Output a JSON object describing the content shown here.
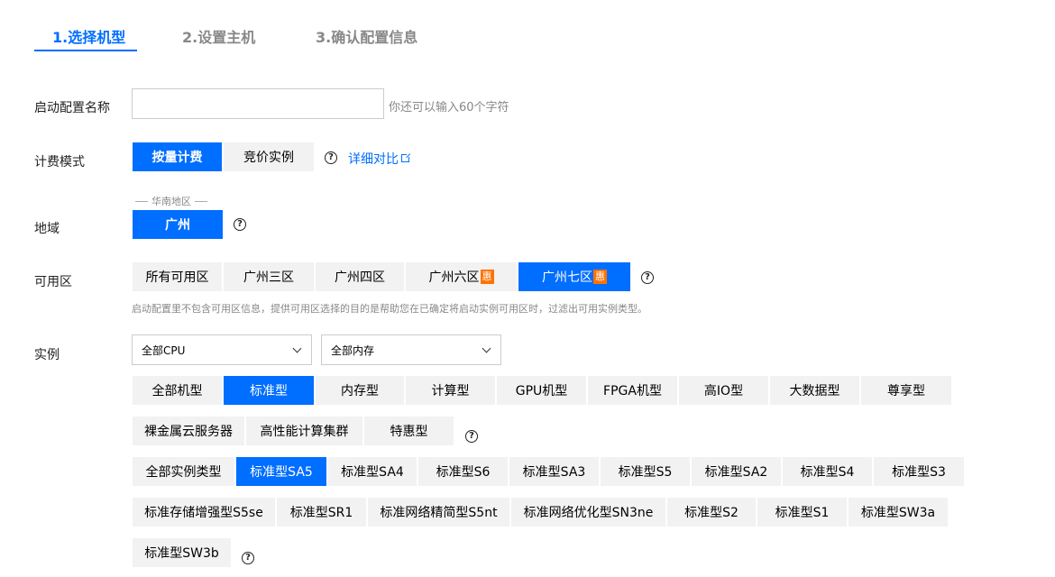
{
  "tabs": [
    "1.选择机型",
    "2.设置主机",
    "3.确认配置信息"
  ],
  "launch_config": {
    "label": "启动配置名称",
    "value": "",
    "hint": "你还可以输入60个字符"
  },
  "billing": {
    "label": "计费模式",
    "options": [
      "按量计费",
      "竞价实例"
    ],
    "selected": "按量计费",
    "compare_link": "详细对比"
  },
  "region": {
    "label": "地域",
    "group": "华南地区",
    "options": [
      "广州"
    ],
    "selected": "广州"
  },
  "zone": {
    "label": "可用区",
    "options": [
      "所有可用区",
      "广州三区",
      "广州四区",
      "广州六区",
      "广州七区"
    ],
    "badge": "惠",
    "selected": "广州七区",
    "note": "启动配置里不包含可用区信息，提供可用区选择的目的是帮助您在已确定将启动实例可用区时，过滤出可用实例类型。"
  },
  "instance": {
    "label": "实例",
    "cpu_select": "全部CPU",
    "mem_select": "全部内存",
    "families": [
      "全部机型",
      "标准型",
      "内存型",
      "计算型",
      "GPU机型",
      "FPGA机型",
      "高IO型",
      "大数据型",
      "尊享型",
      "裸金属云服务器",
      "高性能计算集群",
      "特惠型"
    ],
    "family_selected": "标准型",
    "types": [
      "全部实例类型",
      "标准型SA5",
      "标准型SA4",
      "标准型S6",
      "标准型SA3",
      "标准型S5",
      "标准型SA2",
      "标准型S4",
      "标准型S3",
      "标准存储增强型S5se",
      "标准型SR1",
      "标准网络精简型S5nt",
      "标准网络优化型SN3ne",
      "标准型S2",
      "标准型S1",
      "标准型SW3a",
      "标准型SW3b"
    ],
    "type_selected": "标准型SA5"
  },
  "colors": {
    "accent": "#006eff",
    "badge": "#ff7200",
    "muted": "#888888"
  }
}
